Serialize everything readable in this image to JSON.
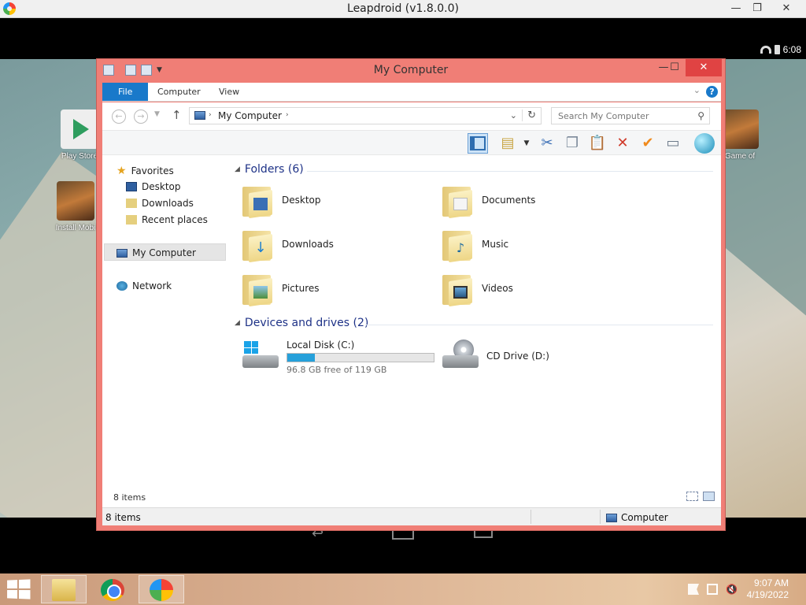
{
  "leapdroid": {
    "title": "Leapdroid (v1.8.0.0)",
    "controls": {
      "minimize": "—",
      "maximize": "❐",
      "close": "✕"
    }
  },
  "android": {
    "status_time": "6:08",
    "apps": [
      {
        "label": "Play Store"
      },
      {
        "label": "Install Mobi"
      },
      {
        "label": "Game of"
      }
    ]
  },
  "explorer": {
    "title": "My Computer",
    "controls": {
      "minimize": "—",
      "maximize": "☐",
      "close": "✕"
    },
    "ribbon_tabs": [
      "File",
      "Computer",
      "View"
    ],
    "help": "?",
    "address": "My Computer",
    "search_placeholder": "Search My Computer",
    "nav": {
      "favorites": "Favorites",
      "desktop": "Desktop",
      "downloads": "Downloads",
      "recent": "Recent places",
      "my_computer": "My Computer",
      "network": "Network"
    },
    "folders_header": "Folders (6)",
    "folders": [
      "Desktop",
      "Documents",
      "Downloads",
      "Music",
      "Pictures",
      "Videos"
    ],
    "drives_header": "Devices and drives (2)",
    "drives": [
      {
        "name": "Local Disk (C:)",
        "free_text": "96.8 GB free of 119 GB",
        "used_fraction": 0.186
      },
      {
        "name": "CD Drive (D:)"
      }
    ],
    "items_count": "8 items",
    "status_items": "8 items",
    "status_location": "Computer"
  },
  "taskbar": {
    "time": "9:07 AM",
    "date": "4/19/2022"
  },
  "colors": {
    "window_frame": "#f07e76",
    "accent": "#1979ca",
    "disk_bar": "#26a0da"
  }
}
